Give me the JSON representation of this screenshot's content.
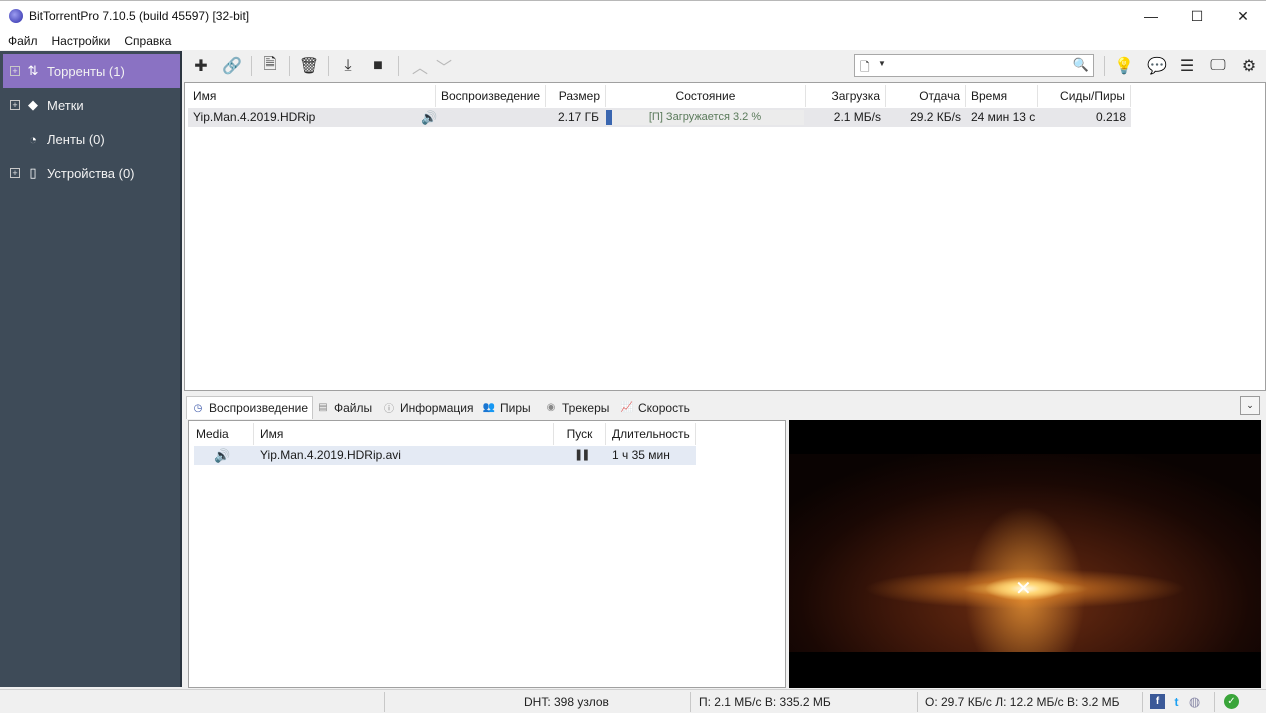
{
  "window": {
    "title": "BitTorrentPro 7.10.5  (build 45597) [32-bit]",
    "minimize_glyph": "—",
    "maximize_glyph": "☐",
    "close_glyph": "✕"
  },
  "menu": [
    "Файл",
    "Настройки",
    "Справка"
  ],
  "sidebar": {
    "items": [
      {
        "label": "Торренты (1)",
        "icon": "transfer-arrows-icon",
        "glyph": "⇅",
        "expandable": true,
        "active": true
      },
      {
        "label": "Метки",
        "icon": "tag-icon",
        "glyph": "◆",
        "expandable": true,
        "active": false
      },
      {
        "label": "Ленты (0)",
        "icon": "rss-icon",
        "glyph": "◔",
        "expandable": false,
        "active": false
      },
      {
        "label": "Устройства (0)",
        "icon": "phone-icon",
        "glyph": "▯",
        "expandable": true,
        "active": false
      }
    ],
    "expand_glyph": "+"
  },
  "toolbar": {
    "buttons": [
      {
        "name": "add-torrent-button",
        "icon": "plus-icon",
        "glyph": "✚"
      },
      {
        "name": "add-link-button",
        "icon": "link-icon",
        "glyph": "🔗"
      },
      {
        "name": "create-torrent-button",
        "icon": "new-file-icon",
        "glyph": "🗎"
      },
      {
        "name": "remove-button",
        "icon": "trash-icon",
        "glyph": "🗑"
      },
      {
        "name": "start-download-button",
        "icon": "download-icon",
        "glyph": "⤓"
      },
      {
        "name": "stop-button",
        "icon": "stop-icon",
        "glyph": "■"
      },
      {
        "name": "move-up-button",
        "icon": "chevron-up-icon",
        "glyph": "︿"
      },
      {
        "name": "move-down-button",
        "icon": "chevron-down-icon",
        "glyph": "﹀"
      }
    ],
    "right_buttons": [
      {
        "name": "tips-button",
        "icon": "lightbulb-icon",
        "glyph": "💡"
      },
      {
        "name": "chat-button",
        "icon": "chat-icon",
        "glyph": "💬"
      },
      {
        "name": "list-view-button",
        "icon": "list-icon",
        "glyph": "☰"
      },
      {
        "name": "remote-button",
        "icon": "monitor-icon",
        "glyph": "🖵"
      },
      {
        "name": "settings-button",
        "icon": "gear-icon",
        "glyph": "⚙"
      }
    ],
    "search": {
      "value": "",
      "placeholder": "",
      "doc_glyph": "🗋",
      "caret_glyph": "▼",
      "search_glyph": "🔍"
    }
  },
  "torrent_table": {
    "columns": [
      "Имя",
      "Воспроизведение",
      "Размер",
      "Состояние",
      "Загрузка",
      "Отдача",
      "Время",
      "Сиды/Пиры"
    ],
    "rows": [
      {
        "name": "Yip.Man.4.2019.HDRip",
        "playback_icon": "speaker-icon",
        "playback_glyph": "🔊",
        "size": "2.17 ГБ",
        "status": "[П] Загружается 3.2 %",
        "progress": 0.032,
        "download": "2.1 МБ/s",
        "upload": "29.2 КБ/s",
        "time": "24 мин 13 с",
        "ratio": "0.218"
      }
    ]
  },
  "bottom_tabs": [
    {
      "label": "Воспроизведение",
      "icon": "playback-icon",
      "glyph": "◷",
      "active": true
    },
    {
      "label": "Файлы",
      "icon": "files-icon",
      "glyph": "▤",
      "active": false
    },
    {
      "label": "Информация",
      "icon": "info-icon",
      "glyph": "ⓘ",
      "active": false
    },
    {
      "label": "Пиры",
      "icon": "peers-icon",
      "glyph": "👥",
      "active": false
    },
    {
      "label": "Трекеры",
      "icon": "tracker-icon",
      "glyph": "◉",
      "active": false
    },
    {
      "label": "Скорость",
      "icon": "speed-chart-icon",
      "glyph": "📈",
      "active": false
    }
  ],
  "collapse_glyph": "⌄",
  "playback_table": {
    "columns": [
      "Media",
      "Имя",
      "Пуск",
      "Длительность"
    ],
    "rows": [
      {
        "media_icon": "speaker-icon",
        "media_glyph": "🔊",
        "name": "Yip.Man.4.2019.HDRip.avi",
        "play_icon": "pause-icon",
        "play_glyph": "❚❚",
        "duration": "1 ч 35 мин"
      }
    ]
  },
  "statusbar": {
    "dht": "DHT: 398 узлов",
    "download": "П: 2.1 МБ/с В: 335.2 МБ",
    "upload": "О: 29.7 КБ/с Л: 12.2 МБ/с В: 3.2 МБ",
    "icons": [
      {
        "name": "facebook-icon",
        "glyph": "f",
        "color": "#3b5998"
      },
      {
        "name": "twitter-icon",
        "glyph": "t",
        "color": "#1da1f2"
      },
      {
        "name": "globe-icon",
        "glyph": "◍",
        "color": "#8a8aa8"
      },
      {
        "name": "connection-ok-icon",
        "glyph": "✓",
        "color": "#3aa53a"
      }
    ]
  },
  "colors": {
    "sidebar_bg": "#3e4b58",
    "sidebar_active": "#8a72c3",
    "progress": "#3a66b0",
    "status_text": "#5a7a5a"
  }
}
